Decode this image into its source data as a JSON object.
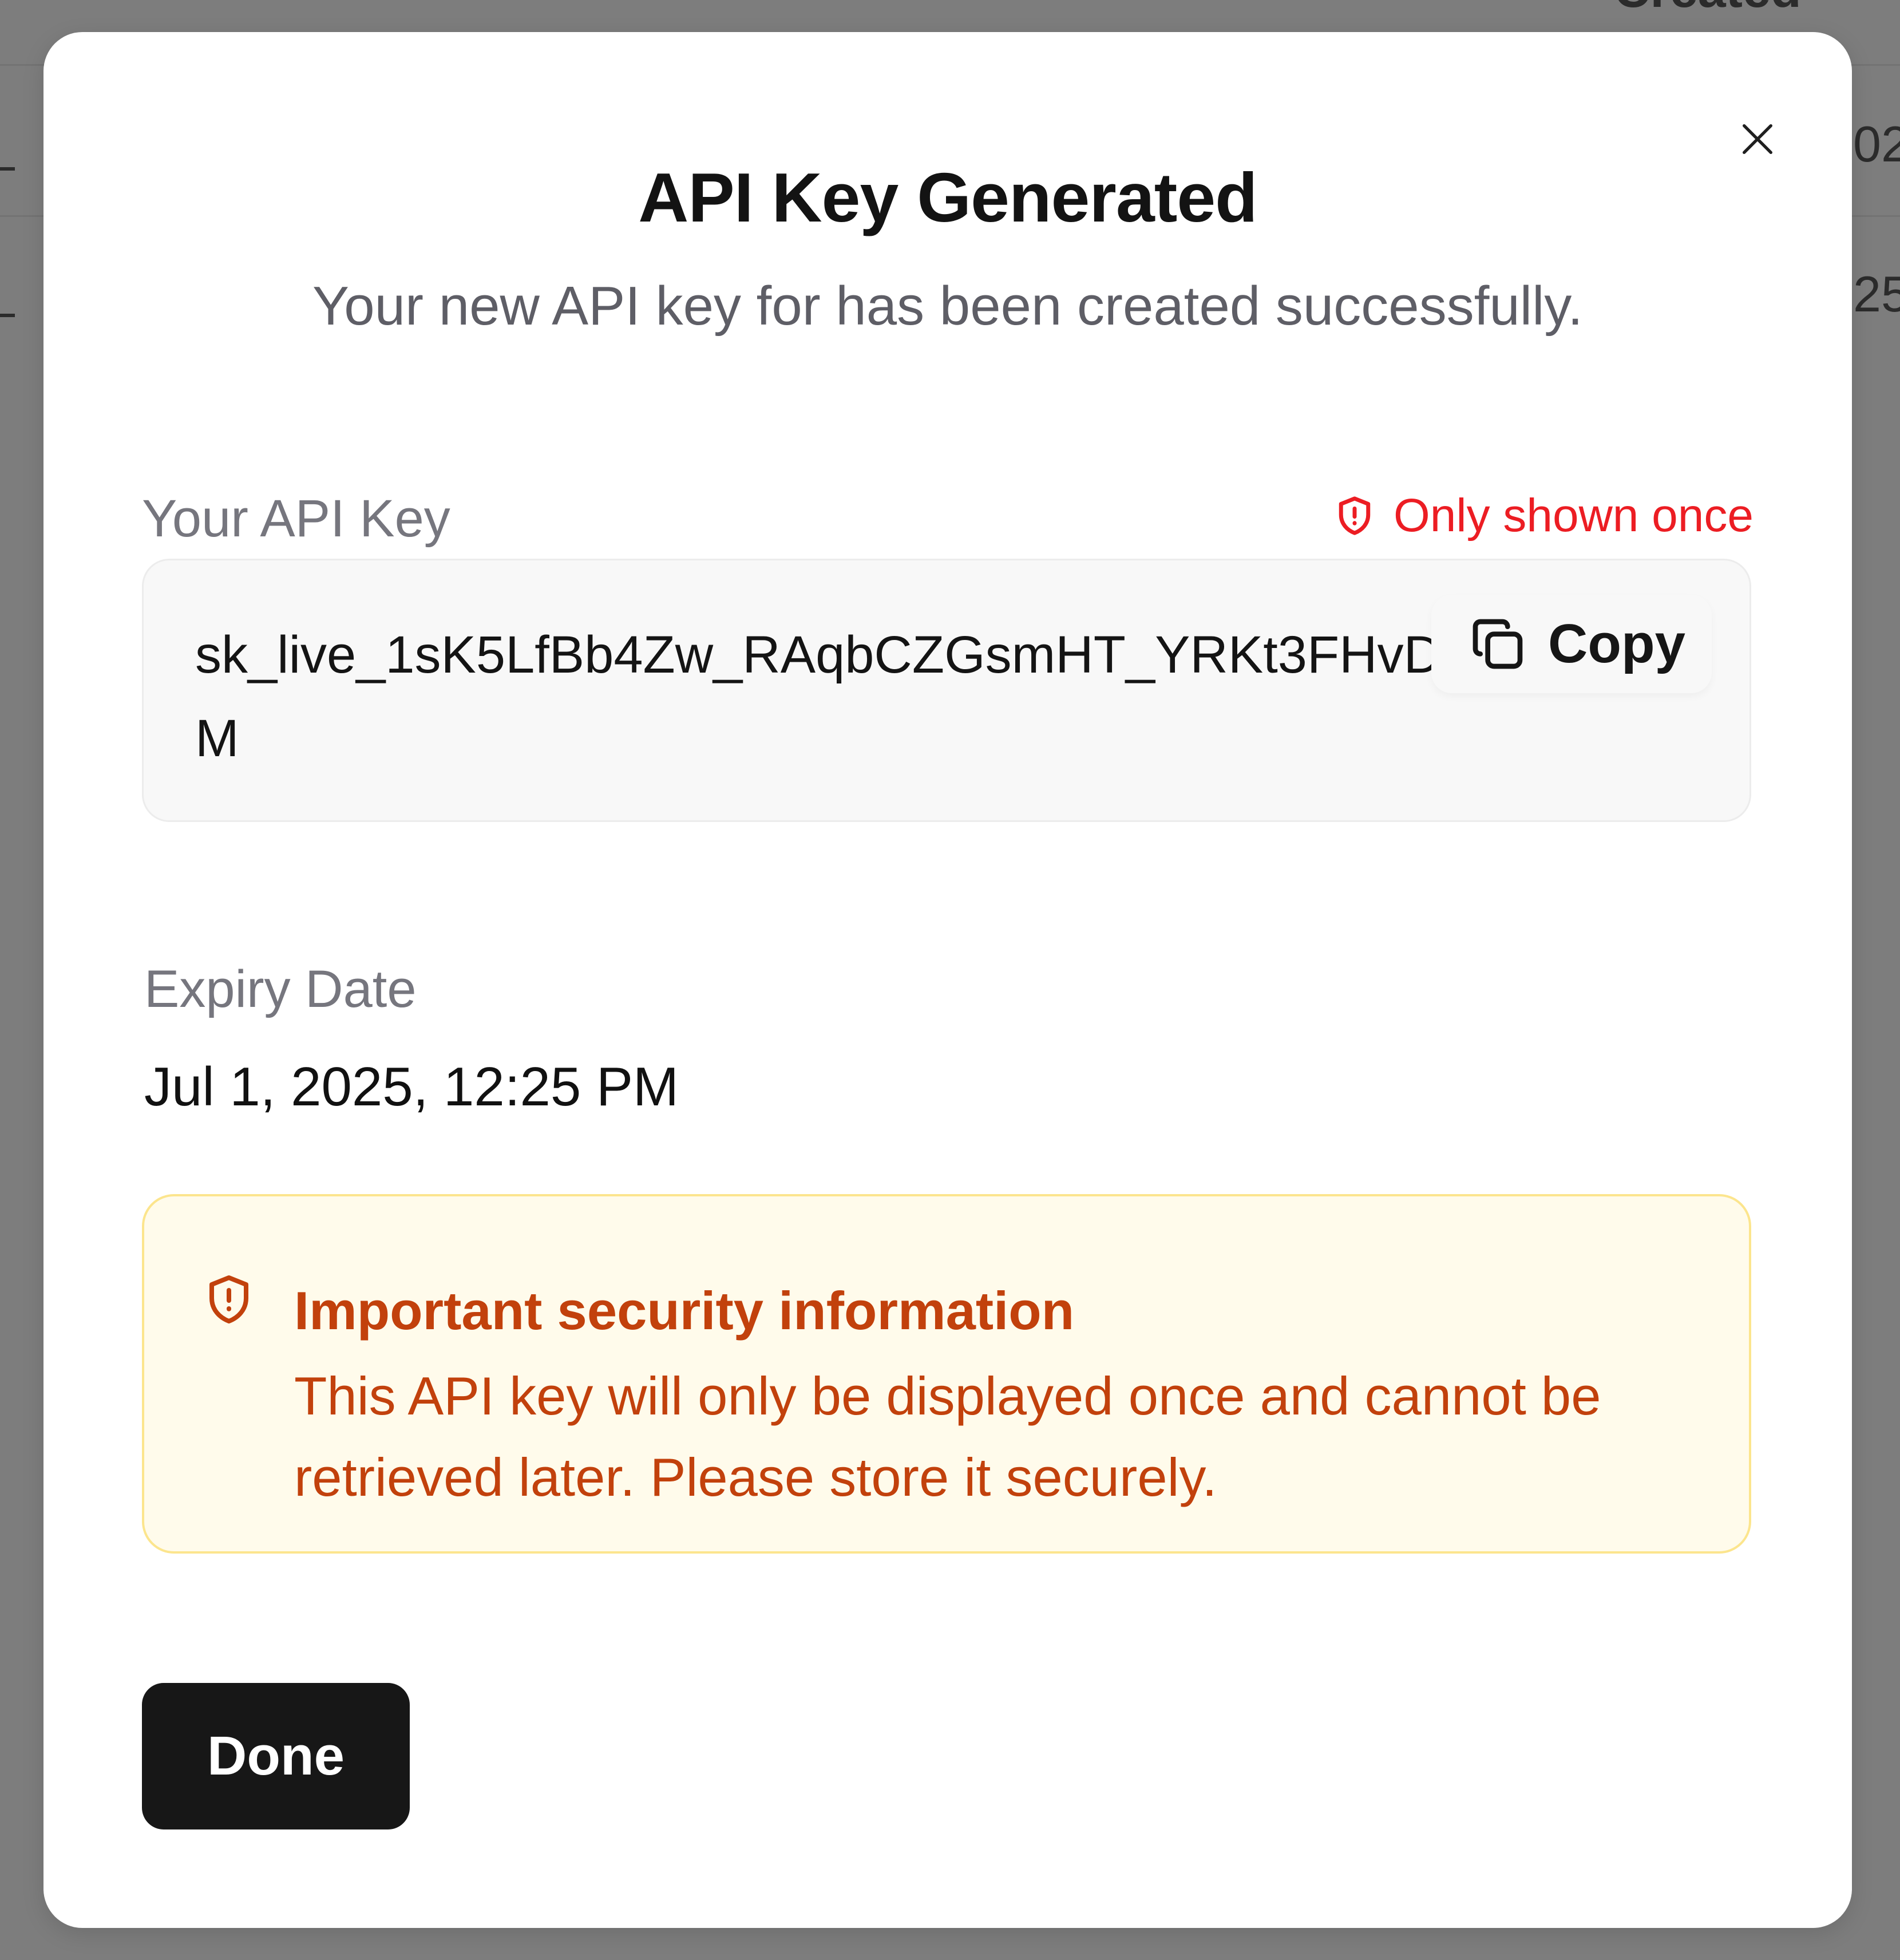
{
  "background": {
    "header_fragment": "Created",
    "row1_fragment": "02",
    "row2_fragment": "25"
  },
  "modal": {
    "title": "API Key Generated",
    "subtitle": "Your new API key for has been created successfully.",
    "close_icon": "close-icon"
  },
  "api_key": {
    "label": "Your API Key",
    "warning": "Only shown once",
    "warning_icon": "shield-alert-icon",
    "warning_color": "#ec1d23",
    "value": "sk_live_1sK5LfBb4Zw_RAqbCZGsmHT_YRKt3FHvDLM",
    "copy_label": "Copy",
    "copy_icon": "copy-icon"
  },
  "expiry": {
    "label": "Expiry Date",
    "value": "Jul 1, 2025, 12:25 PM"
  },
  "security_alert": {
    "icon": "shield-alert-icon",
    "title": "Important security information",
    "body": "This API key will only be displayed once and cannot be retrieved later. Please store it securely.",
    "text_color": "#c2410c",
    "background_color": "#fffbeb",
    "border_color": "#fce58d"
  },
  "footer": {
    "done_label": "Done"
  }
}
